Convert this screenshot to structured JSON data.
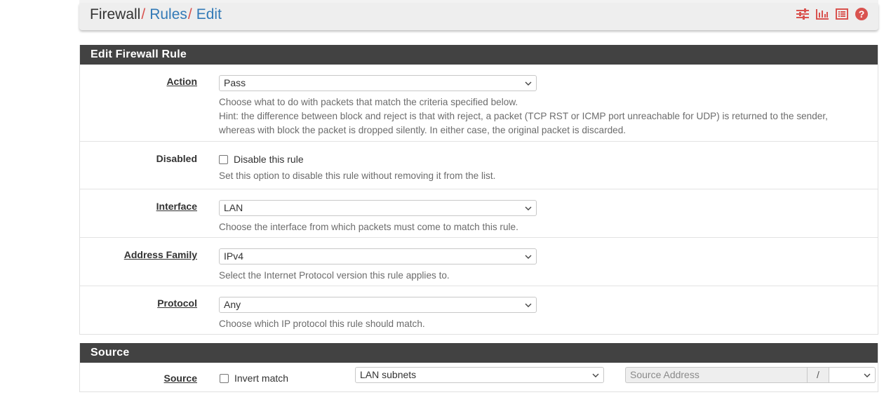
{
  "breadcrumb": {
    "part1": "Firewall",
    "sep1": "/",
    "part2": "Rules",
    "sep2": "/",
    "part3": "Edit"
  },
  "header_icons": [
    "sliders-icon",
    "bar-chart-icon",
    "list-icon",
    "help-icon"
  ],
  "colors": {
    "heading_bg": "#424242",
    "link": "#337ab7",
    "separator": "#d9534f",
    "help_icon": "#d9534f"
  },
  "edit_panel": {
    "title": "Edit Firewall Rule",
    "action": {
      "label": "Action",
      "value": "Pass",
      "help1": "Choose what to do with packets that match the criteria specified below.",
      "help2": "Hint: the difference between block and reject is that with reject, a packet (TCP RST or ICMP port unreachable for UDP) is returned to the sender,",
      "help3": "whereas with block the packet is dropped silently. In either case, the original packet is discarded."
    },
    "disabled": {
      "label": "Disabled",
      "checkbox_label": "Disable this rule",
      "help": "Set this option to disable this rule without removing it from the list."
    },
    "interface": {
      "label": "Interface",
      "value": "LAN",
      "help": "Choose the interface from which packets must come to match this rule."
    },
    "address_family": {
      "label": "Address Family",
      "value": "IPv4",
      "help": "Select the Internet Protocol version this rule applies to."
    },
    "protocol": {
      "label": "Protocol",
      "value": "Any",
      "help": "Choose which IP protocol this rule should match."
    }
  },
  "source_panel": {
    "title": "Source",
    "label": "Source",
    "invert_label": "Invert match",
    "type_value": "LAN subnets",
    "address_placeholder": "Source Address",
    "slash": "/",
    "mask_value": ""
  }
}
